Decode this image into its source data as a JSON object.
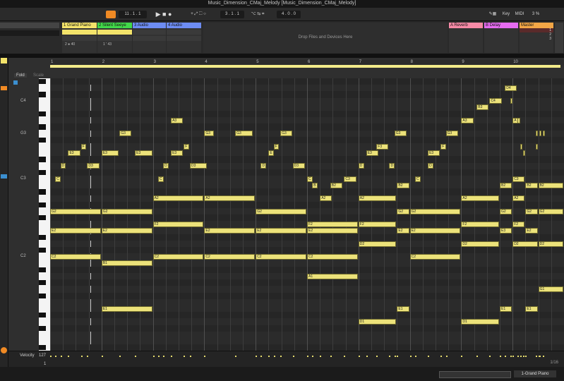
{
  "window": {
    "title": "Music_Dimension_CMaj_Melody  [Music_Dimension_CMaj_Melody]"
  },
  "transport": {
    "position": "11 .  1 .  1",
    "loop_start": "3 .  1 .  1",
    "loop_length": "4 .  0 .  0",
    "key_label": "Key",
    "midi_label": "MIDI",
    "cpu": "3 %"
  },
  "tracks": [
    {
      "name": "1 Grand Piano",
      "color": "#f3e36a"
    },
    {
      "name": "2 Silent Seeye",
      "color": "#42d94a"
    },
    {
      "name": "3 Audio",
      "color": "#6d8cf2"
    },
    {
      "name": "4 Audio",
      "color": "#6d8cf2"
    }
  ],
  "returns": [
    {
      "name": "A Reverb",
      "color": "#f68aa6"
    },
    {
      "name": "B Delay",
      "color": "#e56cf0"
    },
    {
      "name": "Master",
      "color": "#f2a646"
    }
  ],
  "drop_zone": "Drop Files and Devices Here",
  "track_info": {
    "left_values": "2",
    "left_value2": "40",
    "second_values": "1",
    "second_value2": "43"
  },
  "master_slots": [
    "1",
    "2",
    "3"
  ],
  "editor": {
    "fold": "Fold",
    "scale": "Scale",
    "bar_numbers": [
      "1",
      "2",
      "3",
      "4",
      "5",
      "6",
      "7",
      "8",
      "9",
      "10"
    ],
    "octave_labels": [
      "C4",
      "G3",
      "C3",
      "C2"
    ],
    "grid_label": "1/16",
    "velocity_label": "Velocity",
    "velocity_max": "127",
    "velocity_min": "1"
  },
  "notes": [
    {
      "label": "D4",
      "bar": 9.85,
      "len": 0.25,
      "pitch": 38
    },
    {
      "label": "C4",
      "bar": 9.55,
      "len": 0.25,
      "pitch": 36
    },
    {
      "label": "",
      "bar": 9.95,
      "len": 0.06,
      "pitch": 36
    },
    {
      "label": "B3",
      "bar": 9.3,
      "len": 0.25,
      "pitch": 35
    },
    {
      "label": "A3",
      "bar": 3.35,
      "len": 0.25,
      "pitch": 33
    },
    {
      "label": "A3",
      "bar": 9.0,
      "len": 0.25,
      "pitch": 33
    },
    {
      "label": "A",
      "bar": 10.0,
      "len": 0.12,
      "pitch": 33
    },
    {
      "label": "",
      "bar": 10.1,
      "len": 0.06,
      "pitch": 33
    },
    {
      "label": "G3",
      "bar": 2.35,
      "len": 0.25,
      "pitch": 31
    },
    {
      "label": "G3",
      "bar": 4.0,
      "len": 0.2,
      "pitch": 31
    },
    {
      "label": "G3",
      "bar": 4.6,
      "len": 0.35,
      "pitch": 31
    },
    {
      "label": "G3",
      "bar": 5.48,
      "len": 0.25,
      "pitch": 31
    },
    {
      "label": "G3",
      "bar": 7.7,
      "len": 0.25,
      "pitch": 31
    },
    {
      "label": "G3",
      "bar": 8.7,
      "len": 0.25,
      "pitch": 31
    },
    {
      "label": "",
      "bar": 10.45,
      "len": 0.05,
      "pitch": 31
    },
    {
      "label": "",
      "bar": 10.52,
      "len": 0.05,
      "pitch": 31
    },
    {
      "label": "",
      "bar": 10.59,
      "len": 0.05,
      "pitch": 31
    },
    {
      "label": "F",
      "bar": 1.6,
      "len": 0.12,
      "pitch": 29
    },
    {
      "label": "F",
      "bar": 3.6,
      "len": 0.12,
      "pitch": 29
    },
    {
      "label": "F",
      "bar": 5.35,
      "len": 0.12,
      "pitch": 29
    },
    {
      "label": "F3",
      "bar": 7.35,
      "len": 0.25,
      "pitch": 29
    },
    {
      "label": "F",
      "bar": 8.6,
      "len": 0.12,
      "pitch": 29
    },
    {
      "label": "",
      "bar": 10.15,
      "len": 0.06,
      "pitch": 29
    },
    {
      "label": "",
      "bar": 10.45,
      "len": 0.05,
      "pitch": 29
    },
    {
      "label": "E3",
      "bar": 1.35,
      "len": 0.25,
      "pitch": 28
    },
    {
      "label": "E3",
      "bar": 2.0,
      "len": 0.35,
      "pitch": 28
    },
    {
      "label": "E3",
      "bar": 2.65,
      "len": 0.35,
      "pitch": 28
    },
    {
      "label": "E3",
      "bar": 3.35,
      "len": 0.25,
      "pitch": 28
    },
    {
      "label": "E",
      "bar": 5.25,
      "len": 0.12,
      "pitch": 28
    },
    {
      "label": "E3",
      "bar": 7.15,
      "len": 0.25,
      "pitch": 28
    },
    {
      "label": "E3",
      "bar": 8.35,
      "len": 0.25,
      "pitch": 28
    },
    {
      "label": "",
      "bar": 10.2,
      "len": 0.06,
      "pitch": 28
    },
    {
      "label": "D",
      "bar": 1.2,
      "len": 0.12,
      "pitch": 26
    },
    {
      "label": "D3",
      "bar": 1.72,
      "len": 0.25,
      "pitch": 26
    },
    {
      "label": "D",
      "bar": 3.2,
      "len": 0.12,
      "pitch": 26
    },
    {
      "label": "D3",
      "bar": 3.72,
      "len": 0.35,
      "pitch": 26
    },
    {
      "label": "D",
      "bar": 5.1,
      "len": 0.12,
      "pitch": 26
    },
    {
      "label": "D3",
      "bar": 5.72,
      "len": 0.25,
      "pitch": 26
    },
    {
      "label": "D",
      "bar": 7.0,
      "len": 0.12,
      "pitch": 26
    },
    {
      "label": "D",
      "bar": 7.6,
      "len": 0.12,
      "pitch": 26
    },
    {
      "label": "D",
      "bar": 8.35,
      "len": 0.12,
      "pitch": 26
    },
    {
      "label": "C",
      "bar": 1.1,
      "len": 0.12,
      "pitch": 24
    },
    {
      "label": "C",
      "bar": 3.1,
      "len": 0.12,
      "pitch": 24
    },
    {
      "label": "C",
      "bar": 6.0,
      "len": 0.12,
      "pitch": 24
    },
    {
      "label": "C3",
      "bar": 6.72,
      "len": 0.25,
      "pitch": 24
    },
    {
      "label": "C",
      "bar": 8.1,
      "len": 0.12,
      "pitch": 24
    },
    {
      "label": "C3",
      "bar": 10.0,
      "len": 0.25,
      "pitch": 24
    },
    {
      "label": "B",
      "bar": 6.1,
      "len": 0.12,
      "pitch": 23
    },
    {
      "label": "B2",
      "bar": 6.45,
      "len": 0.25,
      "pitch": 23
    },
    {
      "label": "B2",
      "bar": 7.75,
      "len": 0.25,
      "pitch": 23
    },
    {
      "label": "B2",
      "bar": 9.75,
      "len": 0.25,
      "pitch": 23
    },
    {
      "label": "B2",
      "bar": 10.25,
      "len": 0.25,
      "pitch": 23
    },
    {
      "label": "B2",
      "bar": 10.5,
      "len": 0.5,
      "pitch": 23
    },
    {
      "label": "A2",
      "bar": 3.0,
      "len": 1.0,
      "pitch": 21
    },
    {
      "label": "A2",
      "bar": 4.0,
      "len": 1.0,
      "pitch": 21
    },
    {
      "label": "A2",
      "bar": 6.25,
      "len": 0.25,
      "pitch": 21
    },
    {
      "label": "A2",
      "bar": 7.0,
      "len": 0.75,
      "pitch": 21
    },
    {
      "label": "A2",
      "bar": 9.0,
      "len": 0.75,
      "pitch": 21
    },
    {
      "label": "A2",
      "bar": 10.0,
      "len": 0.25,
      "pitch": 21
    },
    {
      "label": "G2",
      "bar": 1.0,
      "len": 1.0,
      "pitch": 19
    },
    {
      "label": "G2",
      "bar": 2.0,
      "len": 1.0,
      "pitch": 19
    },
    {
      "label": "G2",
      "bar": 5.0,
      "len": 1.0,
      "pitch": 19
    },
    {
      "label": "G2",
      "bar": 7.75,
      "len": 0.25,
      "pitch": 19
    },
    {
      "label": "G2",
      "bar": 8.0,
      "len": 1.0,
      "pitch": 19
    },
    {
      "label": "G2",
      "bar": 9.75,
      "len": 0.25,
      "pitch": 19
    },
    {
      "label": "G2",
      "bar": 10.25,
      "len": 0.25,
      "pitch": 19
    },
    {
      "label": "G2",
      "bar": 10.5,
      "len": 0.5,
      "pitch": 19
    },
    {
      "label": "F2",
      "bar": 3.0,
      "len": 1.0,
      "pitch": 17
    },
    {
      "label": "F2",
      "bar": 6.0,
      "len": 1.0,
      "pitch": 17
    },
    {
      "label": "F2",
      "bar": 7.0,
      "len": 0.75,
      "pitch": 17
    },
    {
      "label": "F2",
      "bar": 9.0,
      "len": 0.75,
      "pitch": 17
    },
    {
      "label": "F2",
      "bar": 10.0,
      "len": 0.25,
      "pitch": 17
    },
    {
      "label": "E2",
      "bar": 1.0,
      "len": 1.0,
      "pitch": 16
    },
    {
      "label": "E2",
      "bar": 2.0,
      "len": 1.0,
      "pitch": 16
    },
    {
      "label": "E2",
      "bar": 4.0,
      "len": 1.0,
      "pitch": 16
    },
    {
      "label": "E2",
      "bar": 5.0,
      "len": 1.0,
      "pitch": 16
    },
    {
      "label": "E2",
      "bar": 6.0,
      "len": 1.0,
      "pitch": 16
    },
    {
      "label": "E2",
      "bar": 7.75,
      "len": 0.25,
      "pitch": 16
    },
    {
      "label": "E2",
      "bar": 8.0,
      "len": 1.0,
      "pitch": 16
    },
    {
      "label": "E3",
      "bar": 9.75,
      "len": 0.25,
      "pitch": 16
    },
    {
      "label": "E2",
      "bar": 10.25,
      "len": 0.25,
      "pitch": 16
    },
    {
      "label": "D2",
      "bar": 7.0,
      "len": 0.75,
      "pitch": 14
    },
    {
      "label": "D2",
      "bar": 9.0,
      "len": 0.75,
      "pitch": 14
    },
    {
      "label": "D2",
      "bar": 10.0,
      "len": 0.5,
      "pitch": 14
    },
    {
      "label": "D2",
      "bar": 10.5,
      "len": 0.5,
      "pitch": 14
    },
    {
      "label": "C2",
      "bar": 1.0,
      "len": 1.0,
      "pitch": 12
    },
    {
      "label": "C2",
      "bar": 3.0,
      "len": 1.0,
      "pitch": 12
    },
    {
      "label": "C2",
      "bar": 4.0,
      "len": 1.0,
      "pitch": 12
    },
    {
      "label": "C2",
      "bar": 5.0,
      "len": 1.0,
      "pitch": 12
    },
    {
      "label": "C2",
      "bar": 6.0,
      "len": 1.0,
      "pitch": 12
    },
    {
      "label": "C2",
      "bar": 8.0,
      "len": 1.0,
      "pitch": 12
    },
    {
      "label": "B1",
      "bar": 2.0,
      "len": 1.0,
      "pitch": 11
    },
    {
      "label": "A1",
      "bar": 6.0,
      "len": 1.0,
      "pitch": 9
    },
    {
      "label": "G1",
      "bar": 10.5,
      "len": 0.5,
      "pitch": 7
    },
    {
      "label": "E1",
      "bar": 2.0,
      "len": 1.0,
      "pitch": 4
    },
    {
      "label": "E1",
      "bar": 7.75,
      "len": 0.25,
      "pitch": 4
    },
    {
      "label": "E1",
      "bar": 9.75,
      "len": 0.25,
      "pitch": 4
    },
    {
      "label": "E1",
      "bar": 10.25,
      "len": 0.25,
      "pitch": 4
    },
    {
      "label": "D1",
      "bar": 7.0,
      "len": 0.75,
      "pitch": 2
    },
    {
      "label": "D1",
      "bar": 9.0,
      "len": 0.75,
      "pitch": 2
    }
  ],
  "status": {
    "clip_name": "1-Grand Piano"
  }
}
